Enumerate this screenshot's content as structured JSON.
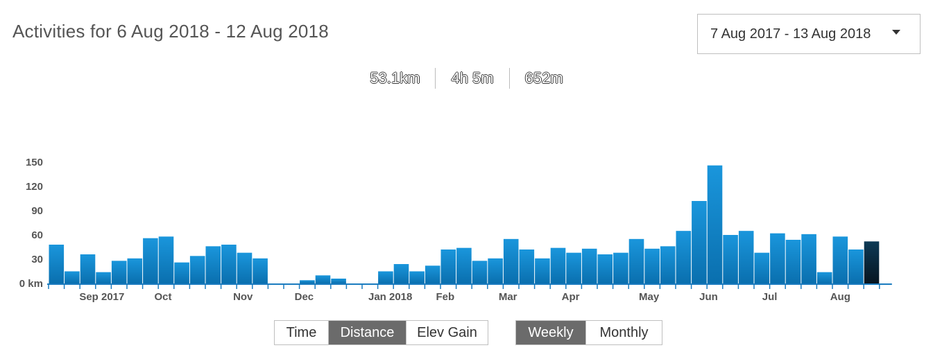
{
  "header": {
    "title": "Activities for 6 Aug 2018 - 12 Aug 2018"
  },
  "range_select": {
    "label": "7 Aug 2017 - 13 Aug 2018"
  },
  "stats": {
    "distance": "53.1km",
    "time": "4h 5m",
    "elevation": "652m"
  },
  "metric_buttons": [
    "Time",
    "Distance",
    "Elev Gain"
  ],
  "metric_active": "Distance",
  "period_buttons": [
    "Weekly",
    "Monthly"
  ],
  "period_active": "Weekly",
  "colors": {
    "bar": "#1a8fd6",
    "bar_selected": "#0b2a3d",
    "axis": "#1a7bbf",
    "active_button": "#6b6b6b"
  },
  "chart_data": {
    "type": "bar",
    "ylabel": "",
    "xlabel": "",
    "ylim": [
      0,
      150
    ],
    "yticks": [
      {
        "value": 150,
        "label": "150"
      },
      {
        "value": 120,
        "label": "120"
      },
      {
        "value": 90,
        "label": "90"
      },
      {
        "value": 60,
        "label": "60"
      },
      {
        "value": 30,
        "label": "30"
      },
      {
        "value": 0,
        "label": "0 km"
      }
    ],
    "week_count": 53,
    "values": [
      48,
      15,
      36,
      14,
      28,
      31,
      56,
      58,
      26,
      34,
      46,
      48,
      38,
      31,
      0,
      0,
      4,
      10,
      6,
      0,
      0,
      15,
      24,
      15,
      22,
      42,
      44,
      28,
      31,
      55,
      42,
      31,
      44,
      38,
      43,
      36,
      38,
      55,
      43,
      46,
      65,
      102,
      146,
      60,
      65,
      38,
      62,
      54,
      61,
      14,
      58,
      42,
      52
    ],
    "selected_index": 52,
    "xtick_labels": [
      {
        "label": "Sep 2017",
        "week": 3.4
      },
      {
        "label": "Oct",
        "week": 7.3
      },
      {
        "label": "Nov",
        "week": 12.4
      },
      {
        "label": "Dec",
        "week": 16.3
      },
      {
        "label": "Jan 2018",
        "week": 21.8
      },
      {
        "label": "Feb",
        "week": 25.3
      },
      {
        "label": "Mar",
        "week": 29.3
      },
      {
        "label": "Apr",
        "week": 33.3
      },
      {
        "label": "May",
        "week": 38.3
      },
      {
        "label": "Jun",
        "week": 42.1
      },
      {
        "label": "Jul",
        "week": 46.0
      },
      {
        "label": "Aug",
        "week": 50.5
      }
    ],
    "grid": false,
    "legend": "none"
  }
}
